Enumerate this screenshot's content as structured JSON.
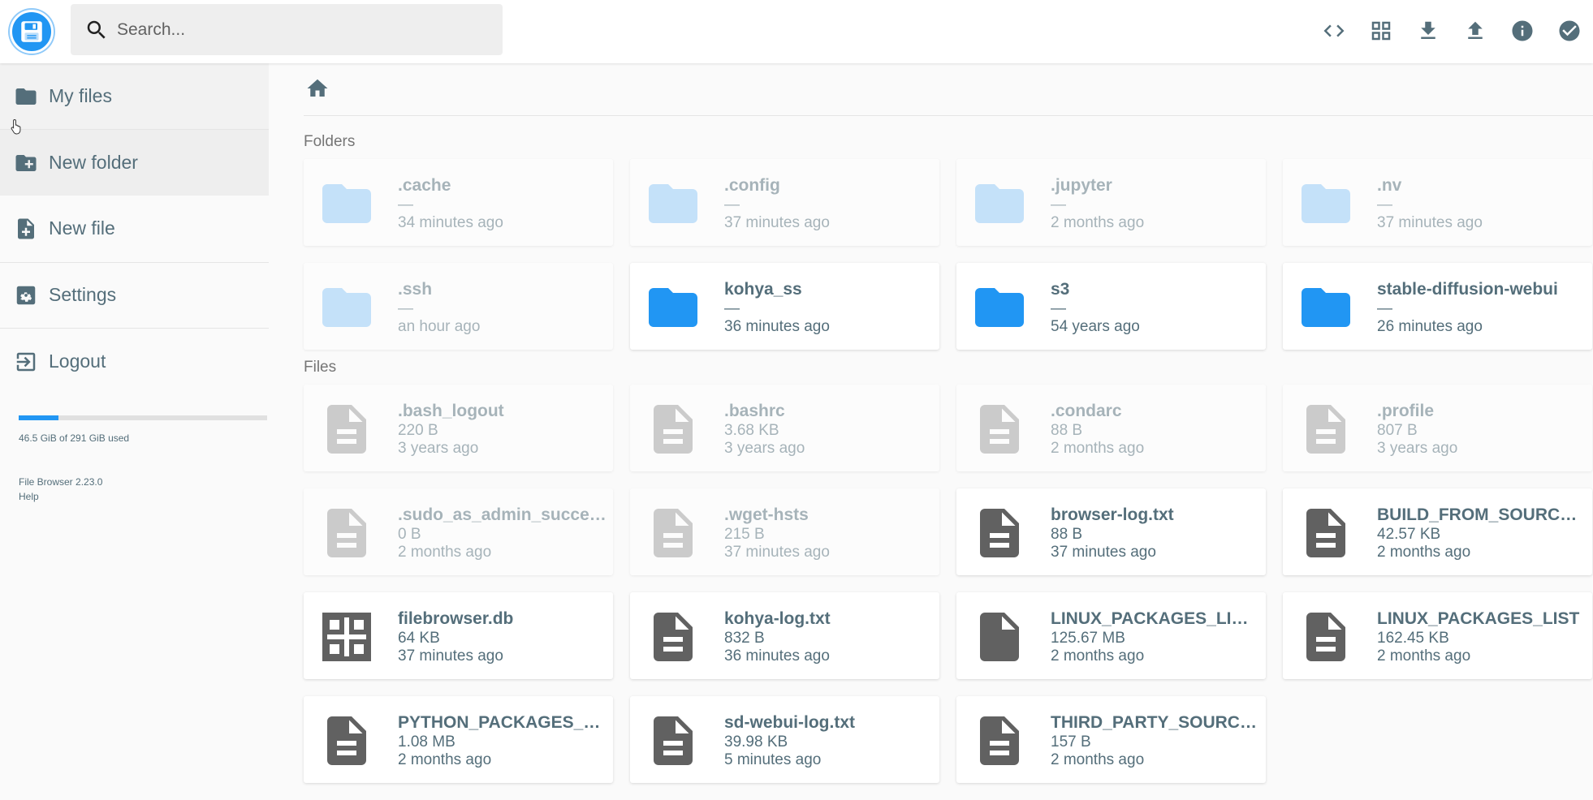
{
  "header": {
    "search_placeholder": "Search...",
    "actions": [
      {
        "name": "code-toggle-button",
        "icon": "code-icon"
      },
      {
        "name": "view-mode-button",
        "icon": "grid-view-icon"
      },
      {
        "name": "download-button",
        "icon": "download-icon"
      },
      {
        "name": "upload-button",
        "icon": "upload-icon"
      },
      {
        "name": "info-button",
        "icon": "info-icon"
      },
      {
        "name": "select-button",
        "icon": "check-circle-icon"
      }
    ]
  },
  "sidebar": {
    "items": [
      {
        "label": "My files",
        "icon": "folder-icon"
      },
      {
        "label": "New folder",
        "icon": "create-new-folder-icon"
      },
      {
        "label": "New file",
        "icon": "note-add-icon"
      },
      {
        "label": "Settings",
        "icon": "settings-icon"
      },
      {
        "label": "Logout",
        "icon": "exit-icon"
      }
    ],
    "usage": {
      "text": "46.5 GiB of 291 GiB used",
      "fraction": 0.16
    },
    "version": "File Browser 2.23.0",
    "help": "Help"
  },
  "main": {
    "folders_title": "Folders",
    "files_title": "Files",
    "folders": [
      {
        "name": ".cache",
        "size": "—",
        "modified": "34 minutes ago",
        "hidden": true
      },
      {
        "name": ".config",
        "size": "—",
        "modified": "37 minutes ago",
        "hidden": true
      },
      {
        "name": ".jupyter",
        "size": "—",
        "modified": "2 months ago",
        "hidden": true
      },
      {
        "name": ".nv",
        "size": "—",
        "modified": "37 minutes ago",
        "hidden": true
      },
      {
        "name": ".ssh",
        "size": "—",
        "modified": "an hour ago",
        "hidden": true
      },
      {
        "name": "kohya_ss",
        "size": "—",
        "modified": "36 minutes ago",
        "hidden": false
      },
      {
        "name": "s3",
        "size": "—",
        "modified": "54 years ago",
        "hidden": false
      },
      {
        "name": "stable-diffusion-webui",
        "size": "—",
        "modified": "26 minutes ago",
        "hidden": false
      }
    ],
    "files": [
      {
        "name": ".bash_logout",
        "size": "220 B",
        "modified": "3 years ago",
        "hidden": true,
        "icon": "text-file-icon"
      },
      {
        "name": ".bashrc",
        "size": "3.68 KB",
        "modified": "3 years ago",
        "hidden": true,
        "icon": "text-file-icon"
      },
      {
        "name": ".condarc",
        "size": "88 B",
        "modified": "2 months ago",
        "hidden": true,
        "icon": "text-file-icon"
      },
      {
        "name": ".profile",
        "size": "807 B",
        "modified": "3 years ago",
        "hidden": true,
        "icon": "text-file-icon"
      },
      {
        "name": ".sudo_as_admin_successful",
        "size": "0 B",
        "modified": "2 months ago",
        "hidden": true,
        "icon": "text-file-icon"
      },
      {
        "name": ".wget-hsts",
        "size": "215 B",
        "modified": "37 minutes ago",
        "hidden": true,
        "icon": "text-file-icon"
      },
      {
        "name": "browser-log.txt",
        "size": "88 B",
        "modified": "37 minutes ago",
        "hidden": false,
        "icon": "text-file-icon"
      },
      {
        "name": "BUILD_FROM_SOURCE_PACKAGES_LICENCES",
        "size": "42.57 KB",
        "modified": "2 months ago",
        "hidden": false,
        "icon": "text-file-icon"
      },
      {
        "name": "filebrowser.db",
        "size": "64 KB",
        "modified": "37 minutes ago",
        "hidden": false,
        "icon": "database-grid-icon"
      },
      {
        "name": "kohya-log.txt",
        "size": "832 B",
        "modified": "36 minutes ago",
        "hidden": false,
        "icon": "text-file-icon"
      },
      {
        "name": "LINUX_PACKAGES_LICENCES",
        "size": "125.67 MB",
        "modified": "2 months ago",
        "hidden": false,
        "icon": "blank-file-icon"
      },
      {
        "name": "LINUX_PACKAGES_LIST",
        "size": "162.45 KB",
        "modified": "2 months ago",
        "hidden": false,
        "icon": "text-file-icon"
      },
      {
        "name": "PYTHON_PACKAGES_LICENCES",
        "size": "1.08 MB",
        "modified": "2 months ago",
        "hidden": false,
        "icon": "text-file-icon"
      },
      {
        "name": "sd-webui-log.txt",
        "size": "39.98 KB",
        "modified": "5 minutes ago",
        "hidden": false,
        "icon": "text-file-icon"
      },
      {
        "name": "THIRD_PARTY_SOURCE_CODE",
        "size": "157 B",
        "modified": "2 months ago",
        "hidden": false,
        "icon": "text-file-icon"
      }
    ]
  },
  "colors": {
    "accent": "#2196f3",
    "folder": "#2196f3",
    "hidden_folder": "#90caf9",
    "file_icon": "#616161",
    "text": "#546e7a"
  }
}
